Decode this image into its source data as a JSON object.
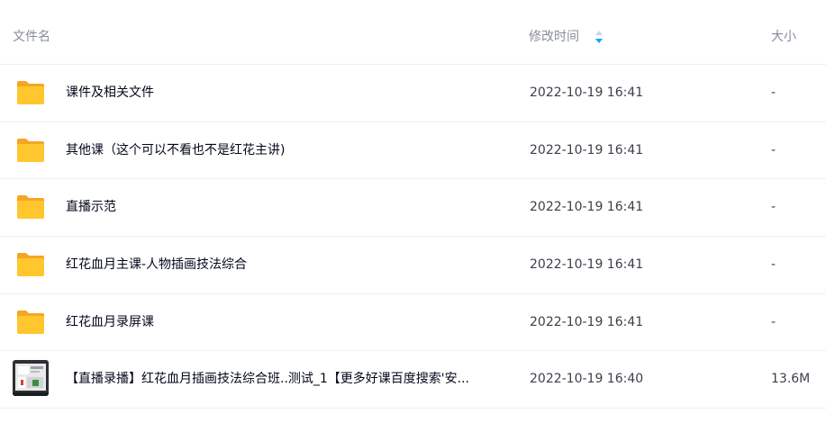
{
  "header": {
    "name_label": "文件名",
    "time_label": "修改时间",
    "size_label": "大小",
    "sort_icon": "sort-toggle-icon"
  },
  "colors": {
    "folder_front": "#ffc62e",
    "folder_back": "#f5a623",
    "sort_active": "#06a7ff",
    "sort_inactive": "#c4d7ef"
  },
  "files": [
    {
      "name": "课件及相关文件",
      "time": "2022-10-19 16:41",
      "size": "-",
      "icon": "folder-icon"
    },
    {
      "name": "其他课（这个可以不看也不是红花主讲)",
      "time": "2022-10-19 16:41",
      "size": "-",
      "icon": "folder-icon"
    },
    {
      "name": "直播示范",
      "time": "2022-10-19 16:41",
      "size": "-",
      "icon": "folder-icon"
    },
    {
      "name": "红花血月主课-人物插画技法综合",
      "time": "2022-10-19 16:41",
      "size": "-",
      "icon": "folder-icon"
    },
    {
      "name": "红花血月录屏课",
      "time": "2022-10-19 16:41",
      "size": "-",
      "icon": "folder-icon"
    },
    {
      "name": "【直播录播】红花血月插画技法综合班..测试_1【更多好课百度搜索'安...",
      "time": "2022-10-19 16:40",
      "size": "13.6M",
      "icon": "video-thumbnail-icon"
    }
  ]
}
